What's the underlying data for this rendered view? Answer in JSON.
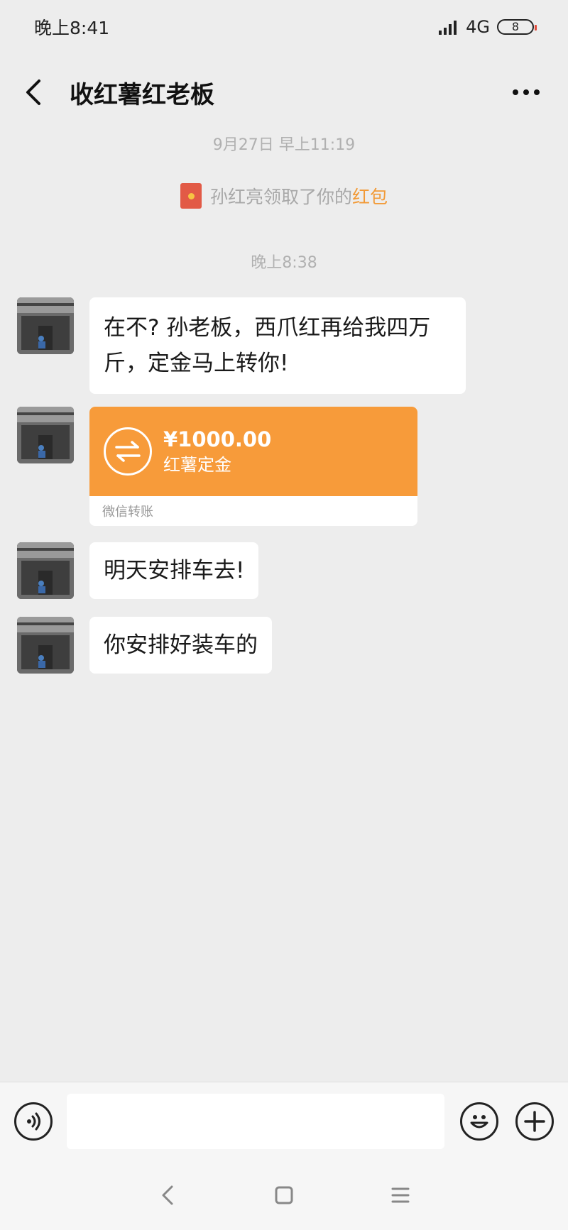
{
  "status_bar": {
    "time": "晚上8:41",
    "network": "4G",
    "battery": "8"
  },
  "header": {
    "title": "收红薯红老板",
    "back_icon": "chevron-left-icon",
    "more_icon": "more-dots-icon"
  },
  "chat": {
    "timestamp_1": "9月27日 早上11:19",
    "system_message": {
      "text": "孙红亮领取了你的",
      "link": "红包",
      "icon": "red-packet-icon"
    },
    "timestamp_2": "晚上8:38",
    "messages": [
      {
        "line1": "在不? 孙老板，西爪红再给我四万",
        "line2": "斤，定金马上转你!"
      },
      {
        "transfer": {
          "amount": "¥1000.00",
          "note": "红薯定金",
          "footer": "微信转账"
        }
      },
      {
        "text": "明天安排车去!"
      },
      {
        "text": "你安排好装车的"
      }
    ]
  },
  "input_bar": {
    "voice_icon": "voice-icon",
    "emoji_icon": "emoji-icon",
    "plus_icon": "plus-icon",
    "placeholder": ""
  },
  "nav_bar": {
    "back": "back-nav-icon",
    "home": "home-nav-icon",
    "menu": "menu-nav-icon"
  },
  "colors": {
    "background": "#ededed",
    "bubble": "#ffffff",
    "transfer": "#f79b3a",
    "link": "#f29a37",
    "red_packet": "#e25a46"
  }
}
